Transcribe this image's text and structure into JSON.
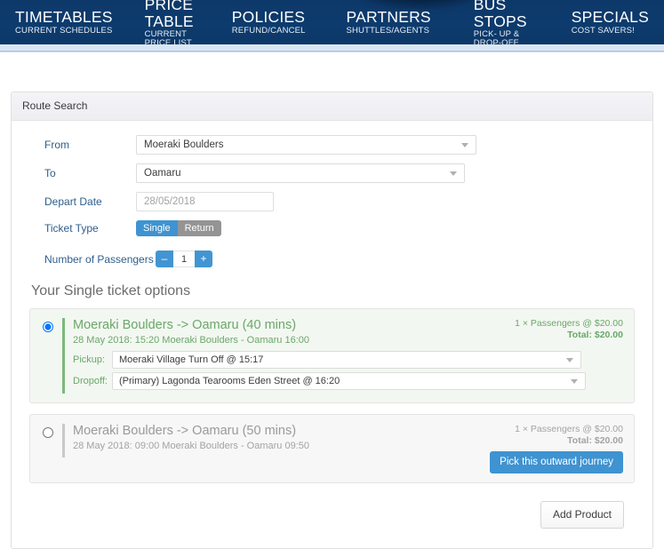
{
  "nav": {
    "items": [
      {
        "title": "TIMETABLES",
        "sub": "CURRENT SCHEDULES"
      },
      {
        "title": "PRICE TABLE",
        "sub": "CURRENT PRICE LIST"
      },
      {
        "title": "POLICIES",
        "sub": "REFUND/CANCEL"
      },
      {
        "title": "PARTNERS",
        "sub": "SHUTTLES/AGENTS"
      },
      {
        "title": "BUS STOPS",
        "sub": "PICK- UP & DROP-OFF"
      },
      {
        "title": "SPECIALS",
        "sub": "COST SAVERS!"
      }
    ]
  },
  "panel": {
    "heading": "Route Search"
  },
  "form": {
    "from": {
      "label": "From",
      "value": "Moeraki Boulders"
    },
    "to": {
      "label": "To",
      "value": "Oamaru"
    },
    "depart_date": {
      "label": "Depart Date",
      "value": "28/05/2018",
      "placeholder": "28/05/2018"
    },
    "ticket_type": {
      "label": "Ticket Type",
      "single": "Single",
      "return": "Return",
      "selected": "Single"
    },
    "passengers": {
      "label": "Number of Passengers",
      "decrement": "–",
      "increment": "+",
      "value": "1"
    }
  },
  "options": {
    "title": "Your Single ticket options",
    "items": [
      {
        "selected": true,
        "title": "Moeraki Boulders -> Oamaru (40 mins)",
        "subtitle": "28 May 2018: 15:20 Moeraki Boulders - Oamaru 16:00",
        "price_line": "1 × Passengers @ $20.00",
        "total_line": "Total: $20.00",
        "pickup_label": "Pickup:",
        "pickup_value": "Moeraki Village Turn Off @ 15:17",
        "dropoff_label": "Dropoff:",
        "dropoff_value": "(Primary) Lagonda Tearooms Eden Street @ 16:20"
      },
      {
        "selected": false,
        "title": "Moeraki Boulders -> Oamaru (50 mins)",
        "subtitle": "28 May 2018: 09:00 Moeraki Boulders - Oamaru 09:50",
        "price_line": "1 × Passengers @ $20.00",
        "total_line": "Total: $20.00",
        "pick_button": "Pick this outward journey"
      }
    ]
  },
  "footer": {
    "add_product": "Add Product"
  },
  "colors": {
    "nav_bg": "#0d3b6d",
    "subbar": "#dbe6f2",
    "label_blue": "#2e5e8c",
    "accent_blue": "#3f93d1",
    "accent_green": "#6aa86a",
    "muted_gray": "#9a9a9a"
  }
}
